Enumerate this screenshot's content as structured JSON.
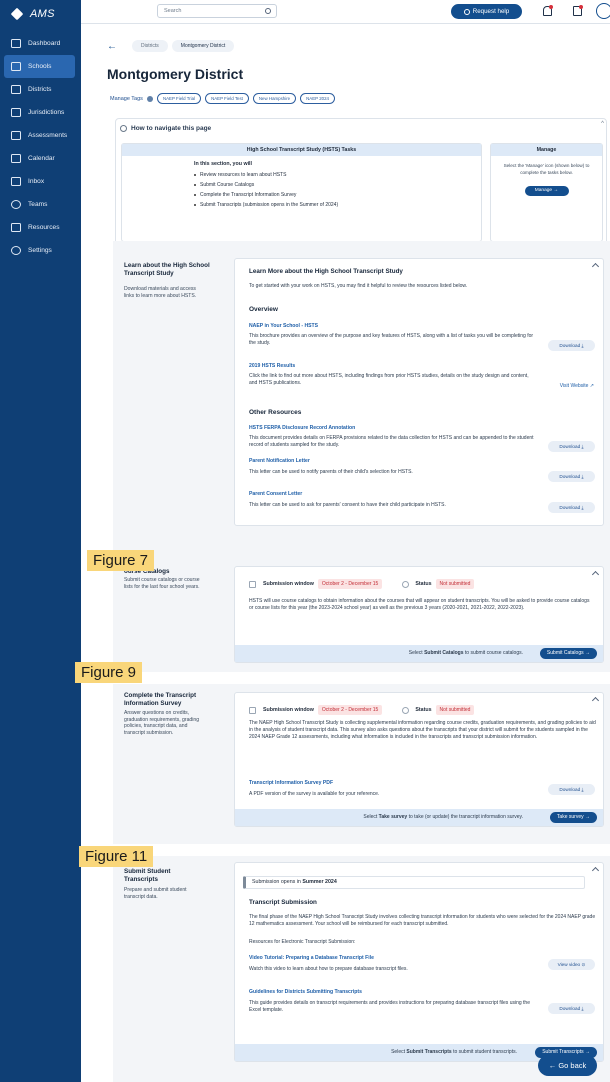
{
  "brand": {
    "name": "AMS"
  },
  "sidebar": {
    "items": [
      {
        "label": "Dashboard"
      },
      {
        "label": "Schools"
      },
      {
        "label": "Districts"
      },
      {
        "label": "Jurisdictions"
      },
      {
        "label": "Assessments"
      },
      {
        "label": "Calendar"
      },
      {
        "label": "Inbox"
      },
      {
        "label": "Teams"
      },
      {
        "label": "Resources"
      },
      {
        "label": "Settings"
      }
    ]
  },
  "topbar": {
    "search_placeholder": "Search",
    "request_help": "Request help"
  },
  "breadcrumbs": [
    "Districts",
    "Montgomery District"
  ],
  "page": {
    "title": "Montgomery District",
    "manage_tags": "Manage Tags",
    "tags": [
      "NAEP Field Trial",
      "NAEP Field Test",
      "New Hampshire",
      "NAEP 2024"
    ]
  },
  "navigate": {
    "title": "How to navigate this page",
    "tasks_title": "High School Transcript Study (HSTS) Tasks",
    "tasks_intro": "In this section, you will",
    "tasks": [
      "Review resources to learn about HSTS",
      "Submit Course Catalogs",
      "Complete the Transcript Information Survey",
      "Submit Transcripts (submission opens in the Summer of 2024)"
    ],
    "manage_title": "Manage",
    "manage_desc": "Select the 'Manage' icon (shown below) to complete the tasks below.",
    "manage_btn": "Manage →"
  },
  "learn": {
    "title": "Learn about the High School Transcript Study",
    "desc": "Download materials and access links to learn more about HSTS.",
    "card_title": "Learn More about the High School Transcript Study",
    "intro": "To get started with your work on HSTS, you may find it helpful to review the resources listed below.",
    "overview": "Overview",
    "other_resources": "Other Resources",
    "resources": [
      {
        "title": "NAEP in Your School - HSTS",
        "desc": "This brochure provides an overview of the purpose and key features of HSTS, along with a list of tasks you will be completing for the study.",
        "action": "Download ⤓"
      },
      {
        "title": "2019 HSTS Results",
        "desc": "Click the link to find out more about HSTS, including findings from prior HSTS studies, details on the study design and content, and HSTS publications.",
        "action": "Visit Website ↗"
      },
      {
        "title": "HSTS FERPA Disclosure Record Annotation",
        "desc": "This document provides details on FERPA provisions related to the data collection for HSTS and can be appended to the student record of students sampled for the study.",
        "action": "Download ⤓"
      },
      {
        "title": "Parent Notification Letter",
        "desc": "This letter can be used to notify parents of their child's selection for HSTS.",
        "action": "Download ⤓"
      },
      {
        "title": "Parent Consent Letter",
        "desc": "This letter can be used to ask for parents' consent to have their child participate in HSTS.",
        "action": "Download ⤓"
      }
    ]
  },
  "figures": {
    "f7": "Figure 7",
    "f9": "Figure 9",
    "f11": "Figure 11"
  },
  "catalogs": {
    "title": "Submit Course Catalogs",
    "title_visible": "ourse Catalogs",
    "desc": "Submit course catalogs or course lists for the last four school years.",
    "submission_label": "Submission window",
    "submission_value": "October 2 - December 15",
    "status_label": "Status",
    "status_value": "Not submitted",
    "body": "HSTS will use course catalogs to obtain information about the courses that will appear on student transcripts. You will be asked to provide course catalogs or course lists for this year (the 2023-2024 school year) as well as the previous 3 years (2020-2021, 2021-2022, 2022-2023).",
    "action_text_pre": "Select ",
    "action_text_bold": "Submit Catalogs",
    "action_text_post": " to submit course catalogs.",
    "action_btn": "Submit Catalogs →"
  },
  "survey": {
    "title": "Complete the Transcript Information Survey",
    "desc": "Answer questions on credits, graduation requirements, grading policies, transcript data, and transcript submission.",
    "submission_label": "Submission window",
    "submission_value": "October 2 - December 15",
    "status_label": "Status",
    "status_value": "Not submitted",
    "body": "The NAEP High School Transcript Study is collecting supplemental information regarding course credits, graduation requirements, and grading policies to aid in the analysis of student transcript data. This survey also asks questions about the transcripts that your district will submit for the students sampled in the 2024 NAEP Grade 12 assessments, including what information is included in the transcripts and transcript submission information.",
    "pdf_title": "Transcript Information Survey PDF",
    "pdf_desc": "A PDF version of the survey is available for your reference.",
    "pdf_action": "Download ⤓",
    "action_text_pre": "Select ",
    "action_text_bold": "Take survey",
    "action_text_post": " to take (or update) the transcript information survey.",
    "action_btn": "Take survey →"
  },
  "transcripts": {
    "title_visible_1": "Submit Student",
    "title_visible_2": "Transcripts",
    "desc": "Prepare and submit student transcript data.",
    "banner_pre": "Submission opens in ",
    "banner_bold": "Summer 2024",
    "subtitle": "Transcript Submission",
    "body": "The final phase of the NAEP High School Transcript Study involves collecting transcript information for students who were selected for the 2024 NAEP grade 12 mathematics assessment. Your school will be reimbursed for each transcript submitted.",
    "resources_label": "Resources for Electronic Transcript Submission:",
    "video_title": "Video Tutorial: Preparing a Database Transcript File",
    "video_desc": "Watch this video to learn about how to prepare database transcript files.",
    "video_action": "View video ⊙",
    "guide_title": "Guidelines for Districts Submitting Transcripts",
    "guide_desc": "This guide provides details on transcript requirements and provides instructions for preparing database transcript files using the Excel template.",
    "guide_action": "Download ⤓",
    "action_text_pre": "Select ",
    "action_text_bold": "Submit Transcripts",
    "action_text_post": " to submit student transcripts.",
    "action_btn": "Submit Transcripts →"
  },
  "go_back": "← Go back"
}
